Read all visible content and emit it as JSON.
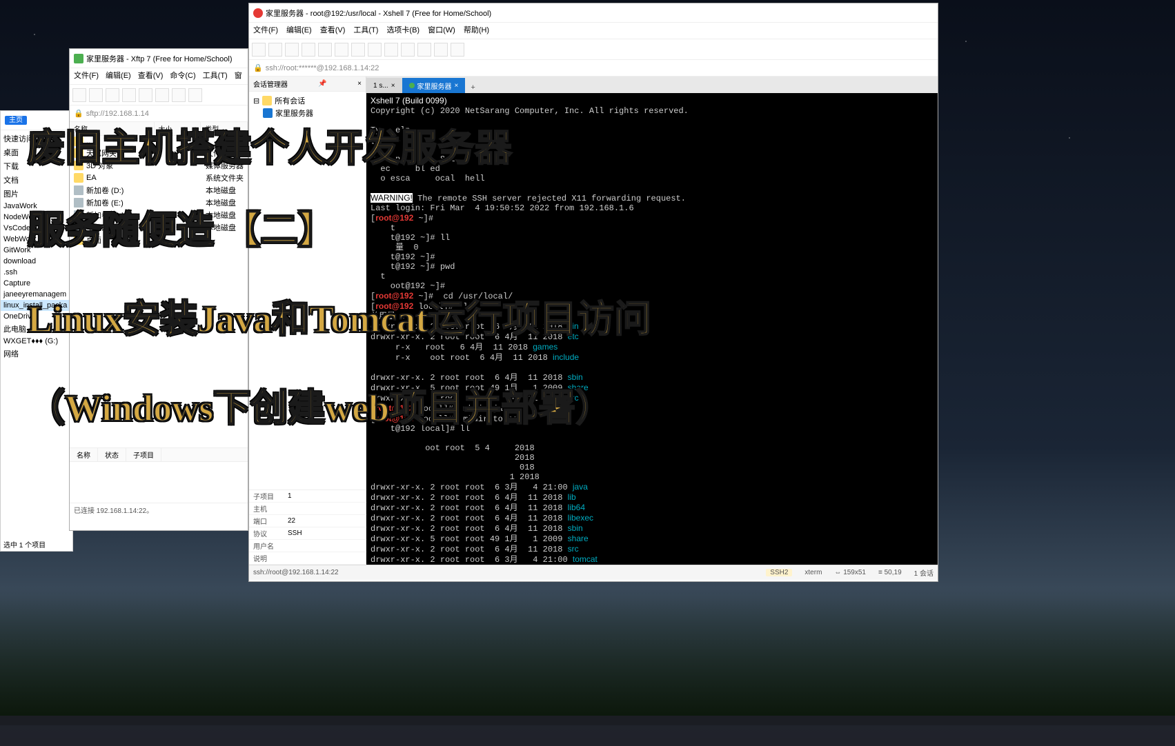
{
  "overlay": {
    "line1": "废旧主机搭建个人开发服务器",
    "line2": "服务随便造 【二】",
    "line3": "Linux安装Java和Tomcat运行项目访问",
    "line4": "（Windows下创建web项目并部署）"
  },
  "explorer": {
    "home": "主页",
    "items": [
      "快速访问",
      "桌面",
      "下载",
      "文档",
      "图片",
      "JavaWork",
      "NodeWork",
      "VsCodeWork",
      "WebWork",
      "GitWork",
      "download",
      ".ssh",
      "Capture",
      "janeeyremanagem",
      "linux_install_packa",
      "OneDrive",
      "此电脑",
      "WXGET♦♦♦ (G:)",
      "网络"
    ],
    "selected": "选中 1 个项目"
  },
  "xftp": {
    "title": "家里服务器 - Xftp 7 (Free for Home/School)",
    "menu": [
      "文件(F)",
      "编辑(E)",
      "查看(V)",
      "命令(C)",
      "工具(T)",
      "窗"
    ],
    "addr": "sftp://192.168.1.14",
    "cols": {
      "name": "名称",
      "size": "大小",
      "type": "类型"
    },
    "rows": [
      {
        "name": "..",
        "type": ""
      },
      {
        "name": "天翼网关",
        "type": "文件夹"
      },
      {
        "name": "3D 对象",
        "type": "媒体服务器"
      },
      {
        "name": "EA",
        "type": "系统文件夹"
      },
      {
        "name": "新加卷 (D:)",
        "type": "本地磁盘",
        "drive": true
      },
      {
        "name": "新加卷 (E:)",
        "type": "本地磁盘",
        "drive": true
      },
      {
        "name": "新加卷 (G:)",
        "type": "本地磁盘",
        "drive": true
      },
      {
        "name": "本地磁盘 (C:)",
        "type": "本地磁盘",
        "drive": true
      },
      {
        "name": "桌面",
        "type": ""
      }
    ],
    "th": {
      "name": "名称",
      "status": "状态",
      "sub": "子项目"
    },
    "connected": "已连接 192.168.1.14:22。"
  },
  "xshell": {
    "title": "家里服务器 - root@192:/usr/local - Xshell 7 (Free for Home/School)",
    "menu": [
      "文件(F)",
      "编辑(E)",
      "查看(V)",
      "工具(T)",
      "选项卡(B)",
      "窗口(W)",
      "帮助(H)"
    ],
    "addr": "ssh://root:******@192.168.1.14:22",
    "sidehdr": "会话管理器",
    "allsess": "所有会话",
    "sessname": "家里服务器",
    "tab_inactive": "1 s...",
    "tab_active": "家里服务器",
    "props": [
      [
        "子项目",
        "1"
      ],
      [
        "主机",
        ""
      ],
      [
        "端口",
        "22"
      ],
      [
        "协议",
        "SSH"
      ],
      [
        "用户名",
        ""
      ],
      [
        "说明",
        ""
      ]
    ],
    "status": {
      "addr": "ssh://root@192.168.1.14:22",
      "ssh2": "SSH2",
      "xterm": "xterm",
      "wh": "159x51",
      "pos": "50,19",
      "sess": "1 会话"
    },
    "term": {
      "l1": "Xshell 7 (Build 0099)",
      "l2": "Copyright (c) 2020 NetSarang Computer, Inc. All rights reserved.",
      "warn": "WARNING!",
      "warntxt": " The remote SSH server rejected X11 forwarding request.",
      "lastlogin": "Last login: Fri Mar  4 19:50:52 2022 from 192.168.1.6",
      "prompt_home": "[root@192 ~]#",
      "prompt_local": "[root@192 local]#",
      "cmd_ll": " ll",
      "cmd_pwd": " pwd",
      "cmd_cd": " cd /usr/local/",
      "cmd_mjava": " mkdir java",
      "cmd_mtomcat": " mkdir tomcat",
      "total0": "总用量 0",
      "perm2": "drwxr-xr-x. 2 root root  6 4月  11 2018 ",
      "perm5_49": "drwxr-xr-x. 5 root root 49 1月   1 2009 ",
      "perm2_3": "drwxr-xr-x. 2 root root  6 3月   4 21:00 ",
      "d_bin": "bin",
      "d_etc": "etc",
      "d_games": "games",
      "d_include": "include",
      "d_sbin": "sbin",
      "d_share": "share",
      "d_src": "src",
      "d_java": "java",
      "d_lib": "lib",
      "d_lib64": "lib64",
      "d_libexec": "libexec",
      "d_tomcat": "tomcat",
      "zero": "      0"
    }
  }
}
